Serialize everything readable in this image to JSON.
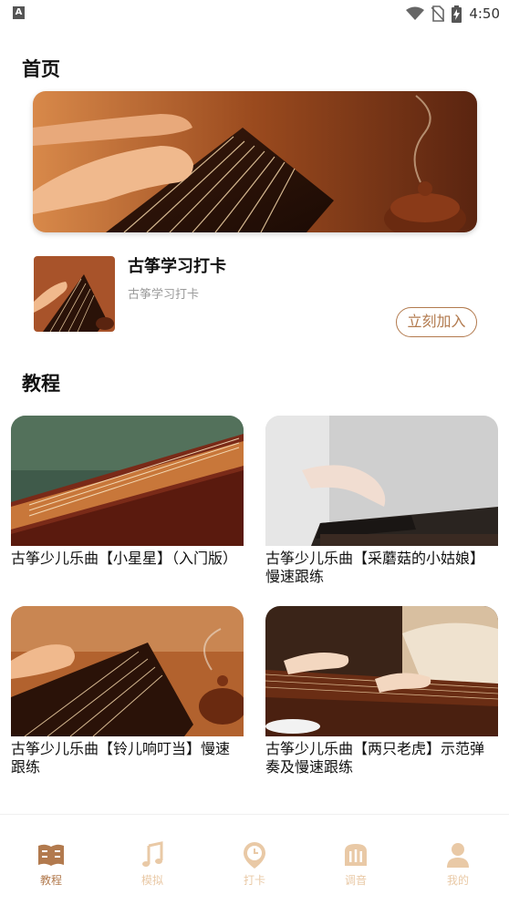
{
  "status_bar": {
    "time": "4:50",
    "left_badge": "A"
  },
  "home": {
    "title": "首页"
  },
  "checkin": {
    "title": "古筝学习打卡",
    "subtitle": "古筝学习打卡",
    "join_label": "立刻加入"
  },
  "tutorials": {
    "title": "教程",
    "items": [
      {
        "caption": "古筝少儿乐曲【小星星】（入门版）"
      },
      {
        "caption": "古筝少儿乐曲【采蘑菇的小姑娘】慢速跟练"
      },
      {
        "caption": "古筝少儿乐曲【铃儿响叮当】慢速跟练"
      },
      {
        "caption": "古筝少儿乐曲【两只老虎】示范弹奏及慢速跟练"
      }
    ]
  },
  "bottom_nav": {
    "items": [
      {
        "label": "教程",
        "icon": "book-icon",
        "active": true
      },
      {
        "label": "模拟",
        "icon": "music-note-icon",
        "active": false
      },
      {
        "label": "打卡",
        "icon": "clock-pin-icon",
        "active": false
      },
      {
        "label": "调音",
        "icon": "tuner-icon",
        "active": false
      },
      {
        "label": "我的",
        "icon": "user-icon",
        "active": false
      }
    ]
  },
  "colors": {
    "accent": "#b27a4e",
    "inactive": "#e9c9a6"
  }
}
